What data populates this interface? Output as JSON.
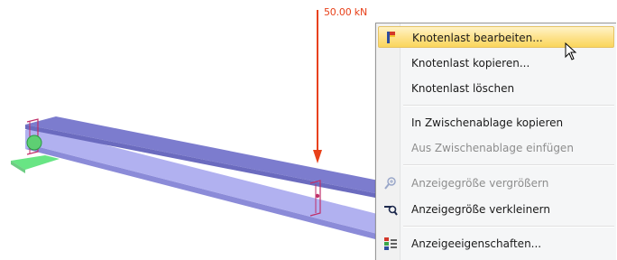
{
  "load": {
    "value_label": "50.00 kN"
  },
  "colors": {
    "load_arrow": "#e8411a",
    "beam_top": "#7f7fd0",
    "beam_web": "#a8a8ee",
    "support": "#4ee06e"
  },
  "context_menu": {
    "items": [
      {
        "label": "Knotenlast bearbeiten...",
        "icon": "edit-load-icon",
        "enabled": true,
        "highlighted": true
      },
      {
        "label": "Knotenlast kopieren...",
        "icon": "",
        "enabled": true,
        "highlighted": false
      },
      {
        "label": "Knotenlast löschen",
        "icon": "",
        "enabled": true,
        "highlighted": false
      },
      {
        "label": "In Zwischenablage kopieren",
        "icon": "",
        "enabled": true,
        "highlighted": false
      },
      {
        "label": "Aus Zwischenablage einfügen",
        "icon": "",
        "enabled": false,
        "highlighted": false
      },
      {
        "label": "Anzeigegröße vergrößern",
        "icon": "zoom-in-icon",
        "enabled": false,
        "highlighted": false
      },
      {
        "label": "Anzeigegröße verkleinern",
        "icon": "zoom-out-icon",
        "enabled": true,
        "highlighted": false
      },
      {
        "label": "Anzeigeeigenschaften...",
        "icon": "display-properties-icon",
        "enabled": true,
        "highlighted": false
      }
    ]
  }
}
